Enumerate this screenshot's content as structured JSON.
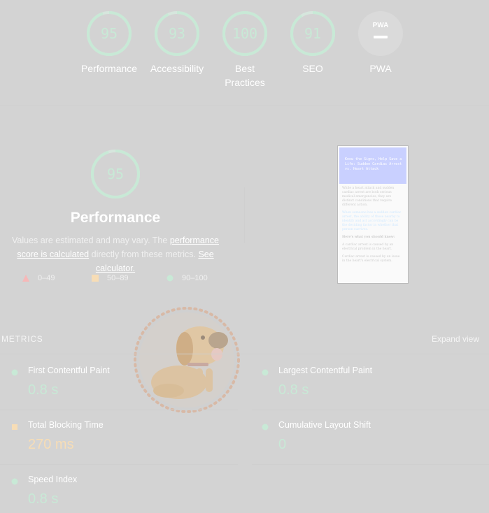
{
  "gauges": [
    {
      "label": "Performance",
      "score": "95",
      "fill": 0.95
    },
    {
      "label": "Accessibility",
      "score": "93",
      "fill": 0.93
    },
    {
      "label": "Best Practices",
      "score": "100",
      "fill": 1.0
    },
    {
      "label": "SEO",
      "score": "91",
      "fill": 0.91
    },
    {
      "label": "PWA",
      "badge": "PWA"
    }
  ],
  "performance": {
    "score": "95",
    "fill": 0.95,
    "title": "Performance",
    "desc_prefix": "Values are estimated and may vary. The ",
    "score_link": "performance score is calculated",
    "desc_middle": " directly from these metrics. ",
    "calculator_link": "See calculator."
  },
  "legend": {
    "low": "0–49",
    "mid": "50–89",
    "high": "90–100"
  },
  "thumbnail": {
    "header": "Know the Signs, Help Save a Life: Sudden Cardiac Arrest vs. Heart Attack",
    "para1": "While a heart attack and sudden cardiac arrest are both serious medical emergencies, they are distinct conditions that require different action.",
    "para2": "When someone has a sudden cardiac arrest, the ability of those nearby to identify and act accordingly can be the deciding factor in whether that person survives.",
    "para3": "Here's what you should know:",
    "para4": "A cardiac arrest is caused by an electrical problem in the heart.",
    "para5": "Cardiac arrest is caused by an issue in the heart's electrical system."
  },
  "metrics": {
    "section_label": "METRICS",
    "expand_label": "Expand view",
    "items": [
      {
        "title": "First Contentful Paint",
        "value": "0.8 s",
        "status": "pass"
      },
      {
        "title": "Largest Contentful Paint",
        "value": "0.8 s",
        "status": "pass"
      },
      {
        "title": "Total Blocking Time",
        "value": "270 ms",
        "status": "average"
      },
      {
        "title": "Cumulative Layout Shift",
        "value": "0",
        "status": "pass"
      },
      {
        "title": "Speed Index",
        "value": "0.8 s",
        "status": "pass"
      }
    ]
  },
  "colors": {
    "pass": "#c8e9d6",
    "average": "#f7ddb6",
    "fail": "#f6b8b8",
    "background": "#d3d3d3"
  }
}
